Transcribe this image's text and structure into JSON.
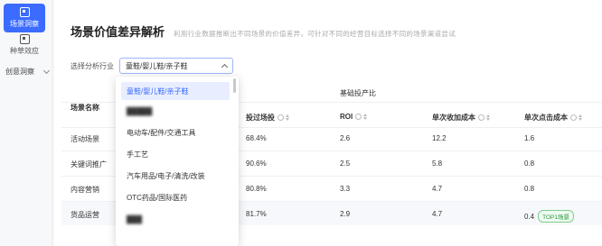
{
  "rail": {
    "items": [
      {
        "label": "场景洞察",
        "active": true
      },
      {
        "label": "种草效应",
        "active": false
      }
    ],
    "group": {
      "label": "创意洞察"
    }
  },
  "header": {
    "title": "场景价值差异解析",
    "subtitle": "利用行业数据推断出不同场景的价值差异，可针对不同的经营目标选择不同的场景渠道尝试"
  },
  "filter": {
    "label": "选择分析行业",
    "selected": "童鞋/婴儿鞋/亲子鞋"
  },
  "dropdown": {
    "options": [
      {
        "label": "童鞋/婴儿鞋/亲子鞋",
        "selected": true,
        "blurred": false
      },
      {
        "label": "█████",
        "selected": false,
        "blurred": true
      },
      {
        "label": "电动车/配件/交通工具",
        "selected": false,
        "blurred": false
      },
      {
        "label": "手工艺",
        "selected": false,
        "blurred": false
      },
      {
        "label": "汽车用品/电子/清洗/改装",
        "selected": false,
        "blurred": false
      },
      {
        "label": "OTC药品/国际医药",
        "selected": false,
        "blurred": false
      },
      {
        "label": "███",
        "selected": false,
        "blurred": true
      }
    ]
  },
  "table": {
    "group_header": "基础投产比",
    "columns": {
      "scene": "场景名称",
      "share": "投过场投",
      "roi": "ROI",
      "cost_add": "单次收加成本",
      "cost_click": "单次点击成本"
    },
    "rows": [
      {
        "scene": "活动场景",
        "share": "68.4%",
        "roi": "2.6",
        "cost_add": "12.2",
        "cost_click": "1.6",
        "badge": ""
      },
      {
        "scene": "关键词推广",
        "share": "90.6%",
        "roi": "2.5",
        "cost_add": "5.8",
        "cost_click": "0.8",
        "badge": ""
      },
      {
        "scene": "内容营销",
        "share": "80.8%",
        "roi": "3.3",
        "cost_add": "4.7",
        "cost_click": "0.8",
        "badge": ""
      },
      {
        "scene": "货品运营",
        "share": "81.7%",
        "roi": "2.9",
        "cost_add": "4.7",
        "cost_click": "0.4",
        "badge": "TOP1场景"
      }
    ]
  }
}
